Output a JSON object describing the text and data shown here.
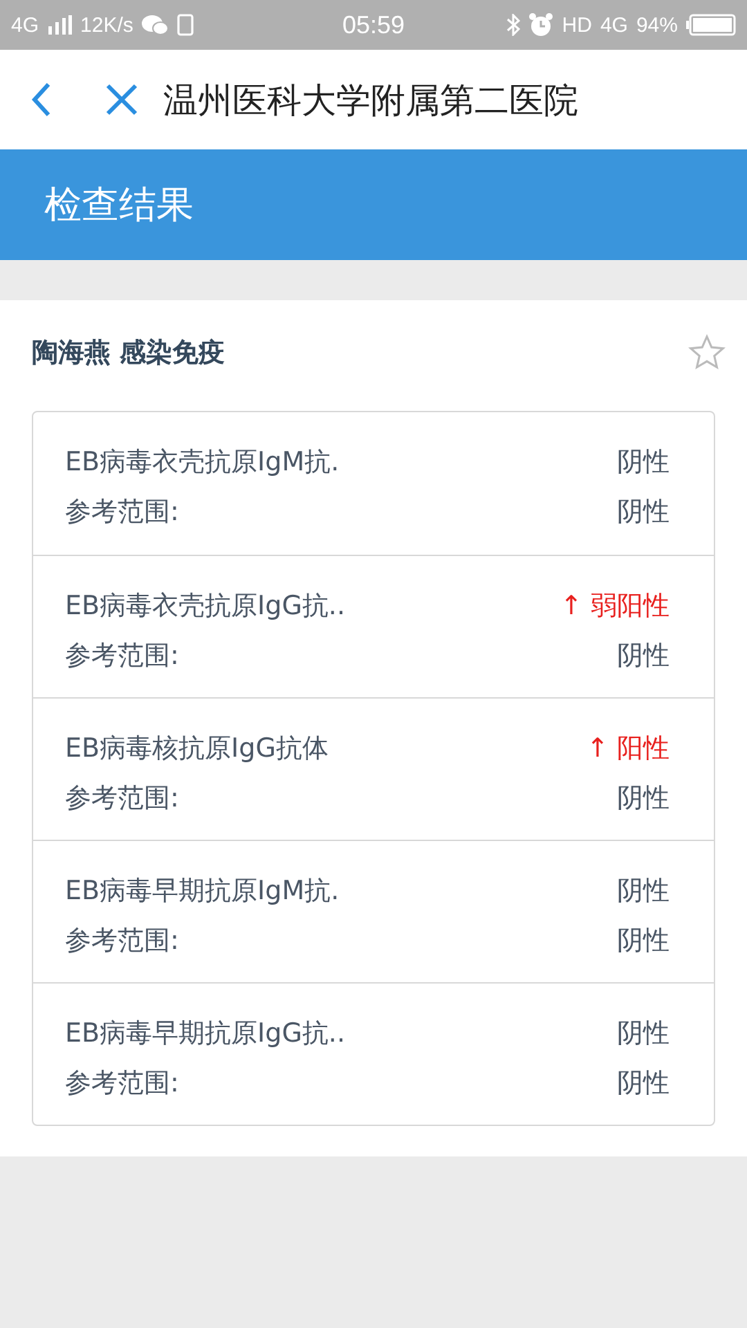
{
  "status_bar": {
    "network": "4G",
    "speed": "12K/s",
    "time": "05:59",
    "hd": "HD",
    "data": "4G",
    "battery": "94%"
  },
  "nav": {
    "title": "温州医科大学附属第二医院"
  },
  "header": {
    "title": "检查结果"
  },
  "report": {
    "title": "陶海燕 感染免疫",
    "starred": false
  },
  "results": [
    {
      "name": "EB病毒衣壳抗原IgM抗.",
      "result": "阴性",
      "abnormal": false,
      "range_label": "参考范围:",
      "range": "阴性"
    },
    {
      "name": "EB病毒衣壳抗原IgG抗..",
      "result": "↑ 弱阳性",
      "abnormal": true,
      "range_label": "参考范围:",
      "range": "阴性"
    },
    {
      "name": "EB病毒核抗原IgG抗体",
      "result": "↑ 阳性",
      "abnormal": true,
      "range_label": "参考范围:",
      "range": "阴性"
    },
    {
      "name": "EB病毒早期抗原IgM抗.",
      "result": "阴性",
      "abnormal": false,
      "range_label": "参考范围:",
      "range": "阴性"
    },
    {
      "name": "EB病毒早期抗原IgG抗..",
      "result": "阴性",
      "abnormal": false,
      "range_label": "参考范围:",
      "range": "阴性"
    }
  ]
}
